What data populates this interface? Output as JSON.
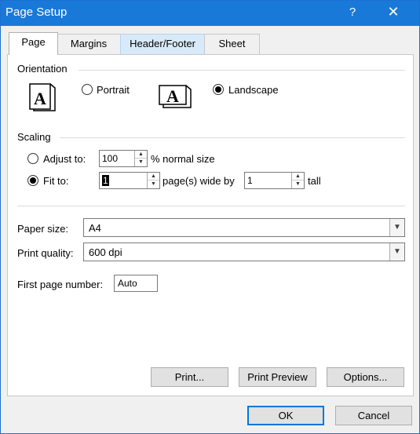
{
  "window": {
    "title": "Page Setup",
    "help_glyph": "?",
    "close_glyph": "✕"
  },
  "tabs": [
    {
      "label": "Page",
      "active": true
    },
    {
      "label": "Margins"
    },
    {
      "label": "Header/Footer"
    },
    {
      "label": "Sheet"
    }
  ],
  "orientation": {
    "heading": "Orientation",
    "portrait": {
      "label": "Portrait",
      "checked": false
    },
    "landscape": {
      "label": "Landscape",
      "checked": true
    },
    "icon_letter": "A"
  },
  "scaling": {
    "heading": "Scaling",
    "adjust": {
      "label": "Adjust to:",
      "value": "100",
      "suffix": "% normal size",
      "checked": false
    },
    "fit": {
      "label": "Fit to:",
      "wide_value": "1",
      "wide_suffix": "page(s) wide by",
      "tall_value": "1",
      "tall_suffix": "tall",
      "checked": true
    }
  },
  "paper_size": {
    "label": "Paper size:",
    "value": "A4"
  },
  "print_quality": {
    "label": "Print quality:",
    "value": "600 dpi"
  },
  "first_page": {
    "label": "First page number:",
    "value": "Auto"
  },
  "buttons": {
    "print": "Print...",
    "preview": "Print Preview",
    "options": "Options...",
    "ok": "OK",
    "cancel": "Cancel"
  },
  "icons": {
    "dropdown": "▼",
    "spin_up": "▲",
    "spin_down": "▼"
  }
}
